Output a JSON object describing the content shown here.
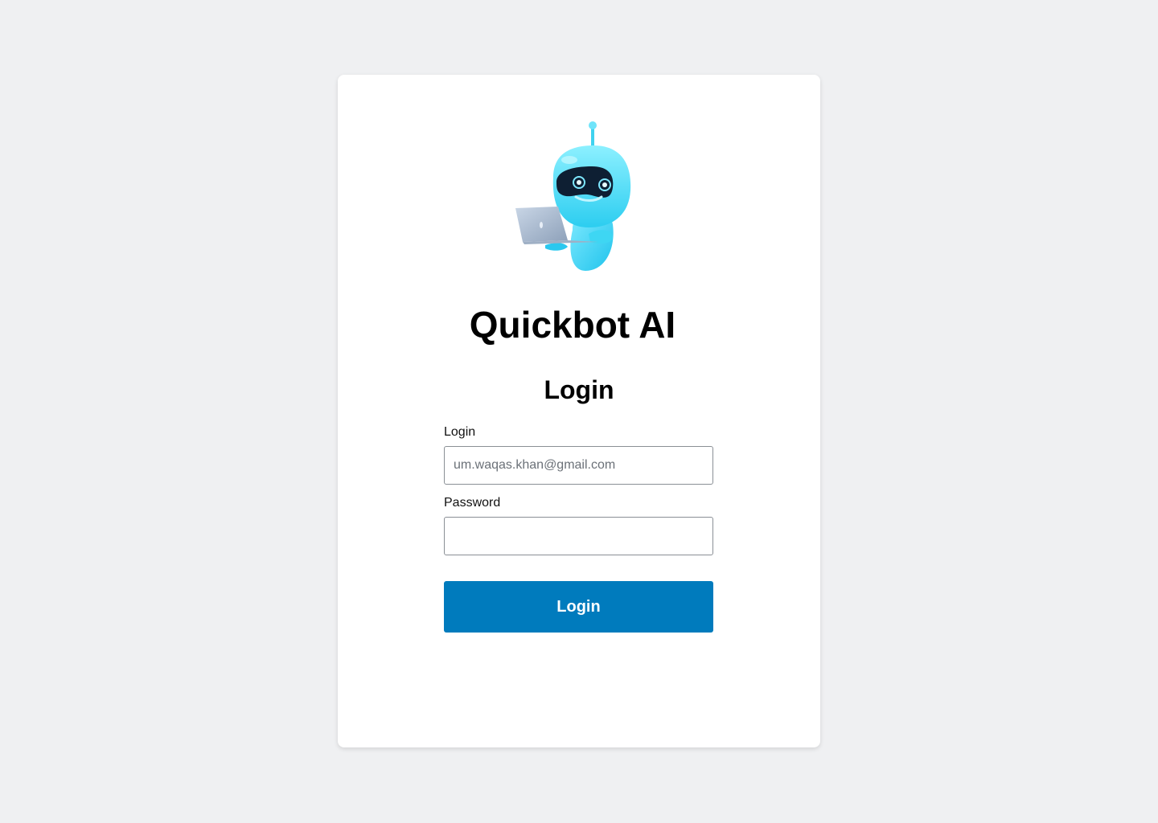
{
  "app": {
    "title": "Quickbot AI",
    "logo_icon": "robot-with-laptop-icon"
  },
  "form": {
    "heading": "Login",
    "login_label": "Login",
    "login_placeholder": "um.waqas.khan@gmail.com",
    "login_value": "",
    "password_label": "Password",
    "password_value": "",
    "submit_label": "Login"
  },
  "colors": {
    "background": "#eff0f2",
    "card": "#ffffff",
    "primary": "#007bbd",
    "robot_body": "#4fdcf5"
  }
}
